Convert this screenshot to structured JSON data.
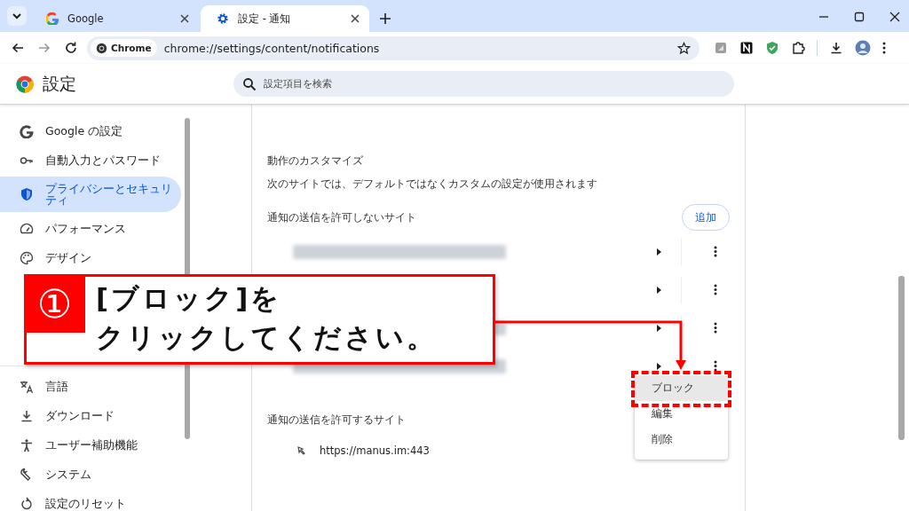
{
  "tabs": [
    {
      "title": "Google",
      "selected": false
    },
    {
      "title": "設定 - 通知",
      "selected": true
    }
  ],
  "address_bar": {
    "chip": "Chrome",
    "url": "chrome://settings/content/notifications"
  },
  "settings_header": {
    "title": "設定",
    "search": {
      "placeholder": "設定項目を検索"
    }
  },
  "sidebar": {
    "groups": [
      {
        "items": [
          {
            "label": "Google の設定",
            "selected": false
          },
          {
            "label": "自動入力とパスワード",
            "selected": false
          },
          {
            "label": "プライバシーとセキュリティ",
            "selected": true
          },
          {
            "label": "パフォーマンス",
            "selected": false
          },
          {
            "label": "デザイン",
            "selected": false
          }
        ]
      },
      {
        "items": [
          {
            "label": "言語",
            "selected": false
          },
          {
            "label": "ダウンロード",
            "selected": false
          },
          {
            "label": "ユーザー補助機能",
            "selected": false
          },
          {
            "label": "システム",
            "selected": false
          },
          {
            "label": "設定のリセット",
            "selected": false
          }
        ]
      }
    ]
  },
  "customize": {
    "heading": "動作のカスタマイズ",
    "description": "次のサイトでは、デフォルトではなくカスタムの設定が使用されます"
  },
  "blocked": {
    "heading": "通知の送信を許可しないサイト",
    "add_button": "追加",
    "rows": [
      {
        "kind": "blurred"
      },
      {
        "kind": "covered"
      },
      {
        "kind": "blurred"
      },
      {
        "kind": "blurred"
      }
    ]
  },
  "allowed": {
    "heading": "通知の送信を許可するサイト",
    "rows": [
      {
        "url": "https://manus.im:443"
      }
    ]
  },
  "context_menu": {
    "items": [
      {
        "label": "ブロック",
        "highlighted": true
      },
      {
        "label": "編集",
        "highlighted": false
      },
      {
        "label": "削除",
        "highlighted": false
      }
    ]
  },
  "callout": {
    "number": "①",
    "lines": [
      "[ブロック]を",
      "クリックしてください。"
    ]
  }
}
